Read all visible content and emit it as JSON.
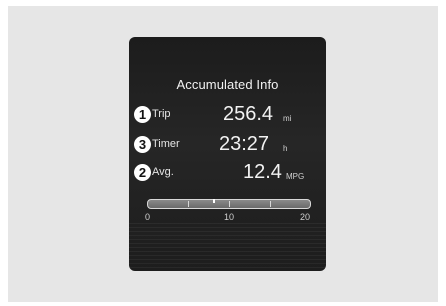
{
  "cluster": {
    "title": "Accumulated Info",
    "rows": [
      {
        "badge": "1",
        "label": "Trip",
        "value": "256.4",
        "unit": "mi"
      },
      {
        "badge": "3",
        "label": "Timer",
        "value": "23:27",
        "unit": "h"
      },
      {
        "badge": "2",
        "label": "Avg.",
        "value": "12.4",
        "unit": "MPG"
      }
    ],
    "gauge": {
      "scale": [
        "0",
        "10",
        "20"
      ],
      "level_fraction": 0.4
    }
  },
  "colors": {
    "screen_bg": "#222222",
    "frame_bg": "#e6e6e6",
    "text": "#f2f2f2"
  }
}
